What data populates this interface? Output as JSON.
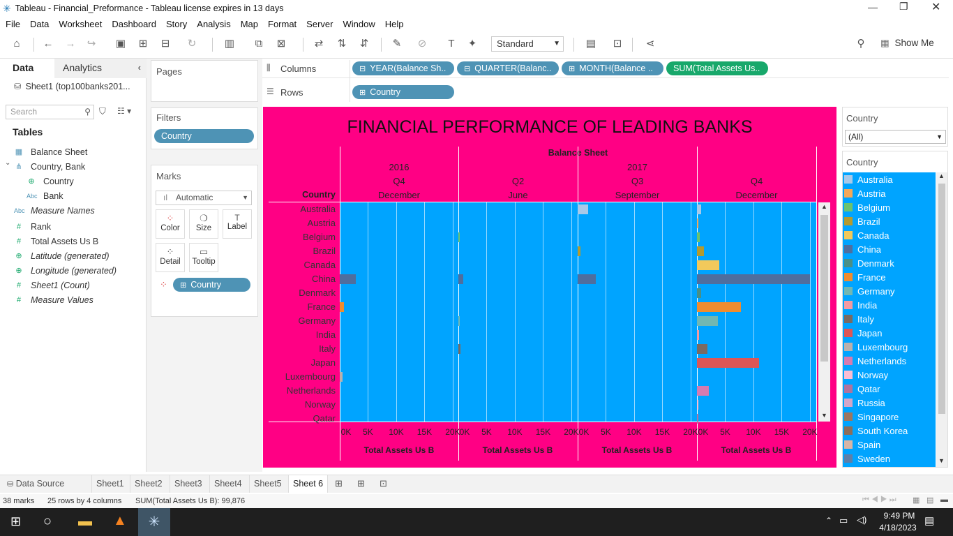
{
  "window": {
    "title": "Tableau - Financial_Preformance - Tableau license expires in 13 days"
  },
  "menu": [
    "File",
    "Data",
    "Worksheet",
    "Dashboard",
    "Story",
    "Analysis",
    "Map",
    "Format",
    "Server",
    "Window",
    "Help"
  ],
  "toolbar": {
    "fit_select": "Standard",
    "show_me": "Show Me"
  },
  "datapane": {
    "tab_data": "Data",
    "tab_analytics": "Analytics",
    "source": "Sheet1 (top100banks201...",
    "search_placeholder": "Search",
    "tables_heading": "Tables",
    "fields": [
      {
        "icon": "calendar-icon",
        "glyph": "▦",
        "label": "Balance Sheet",
        "italic": false,
        "indent": 0
      },
      {
        "icon": "hierarchy-icon",
        "glyph": "⋔",
        "label": "Country, Bank",
        "italic": false,
        "indent": 0
      },
      {
        "icon": "globe-icon",
        "glyph": "⊕",
        "label": "Country",
        "italic": false,
        "indent": 1
      },
      {
        "icon": "abc-icon",
        "glyph": "Abc",
        "label": "Bank",
        "italic": false,
        "indent": 1
      },
      {
        "icon": "abc-icon",
        "glyph": "Abc",
        "label": "Measure Names",
        "italic": true,
        "indent": 0
      },
      {
        "icon": "number-icon",
        "glyph": "#",
        "label": "Rank",
        "italic": false,
        "indent": 0
      },
      {
        "icon": "number-icon",
        "glyph": "#",
        "label": "Total Assets Us B",
        "italic": false,
        "indent": 0
      },
      {
        "icon": "globe-icon",
        "glyph": "⊕",
        "label": "Latitude (generated)",
        "italic": true,
        "indent": 0
      },
      {
        "icon": "globe-icon",
        "glyph": "⊕",
        "label": "Longitude (generated)",
        "italic": true,
        "indent": 0
      },
      {
        "icon": "number-icon",
        "glyph": "#",
        "label": "Sheet1 (Count)",
        "italic": true,
        "indent": 0
      },
      {
        "icon": "number-icon",
        "glyph": "#",
        "label": "Measure Values",
        "italic": true,
        "indent": 0
      }
    ]
  },
  "shelves": {
    "pages": "Pages",
    "filters": "Filters",
    "filter_pill": "Country",
    "marks": "Marks",
    "mark_type": "Automatic",
    "mark_buttons": [
      "Color",
      "Size",
      "Label",
      "Detail",
      "Tooltip"
    ],
    "color_pill": "Country",
    "columns_label": "Columns",
    "rows_label": "Rows",
    "columns": [
      "YEAR(Balance Sh..",
      "QUARTER(Balanc..",
      "MONTH(Balance ..",
      "SUM(Total Assets Us.."
    ],
    "rows": [
      "Country"
    ]
  },
  "viz": {
    "title": "FINANCIAL PERFORMANCE OF LEADING BANKS",
    "header_top": "Balance Sheet",
    "row_header": "Country",
    "years": [
      "2016",
      "2017"
    ],
    "panes": [
      {
        "quarter": "Q4",
        "month": "December"
      },
      {
        "quarter": "Q2",
        "month": "June"
      },
      {
        "quarter": "Q3",
        "month": "September"
      },
      {
        "quarter": "Q4",
        "month": "December"
      }
    ],
    "axis_title": "Total Assets Us B",
    "tick_labels": [
      "0K",
      "5K",
      "10K",
      "15K",
      "20K"
    ]
  },
  "chart_data": {
    "type": "bar",
    "orientation": "horizontal",
    "categories": [
      "Australia",
      "Austria",
      "Belgium",
      "Brazil",
      "Canada",
      "China",
      "Denmark",
      "France",
      "Germany",
      "India",
      "Italy",
      "Japan",
      "Luxembourg",
      "Netherlands",
      "Norway",
      "Qatar"
    ],
    "xlim": [
      0,
      21000
    ],
    "series": [
      {
        "name": "2016 Q4 December",
        "values": [
          0,
          0,
          0,
          0,
          0,
          2900,
          0,
          800,
          0,
          0,
          0,
          0,
          500,
          0,
          0,
          0
        ]
      },
      {
        "name": "2017 Q2 June",
        "values": [
          0,
          0,
          150,
          0,
          0,
          900,
          0,
          0,
          150,
          0,
          400,
          0,
          0,
          0,
          0,
          0
        ]
      },
      {
        "name": "2017 Q3 September",
        "values": [
          1800,
          0,
          0,
          500,
          0,
          3200,
          0,
          0,
          0,
          0,
          0,
          0,
          0,
          0,
          0,
          0
        ]
      },
      {
        "name": "2017 Q4 December",
        "values": [
          700,
          200,
          500,
          1200,
          4000,
          20000,
          700,
          7800,
          3700,
          400,
          1800,
          11000,
          0,
          2100,
          300,
          200
        ]
      }
    ],
    "colors": {
      "Australia": "#a9c9e8",
      "Austria": "#f5a858",
      "Belgium": "#6dc26d",
      "Brazil": "#b49a2e",
      "Canada": "#f2c95b",
      "China": "#4f6e9e",
      "Denmark": "#4a8f86",
      "France": "#f08c2e",
      "Germany": "#72b7b2",
      "India": "#f49aa2",
      "Italy": "#7a6a62",
      "Japan": "#dd5656",
      "Luxembourg": "#bab0ac",
      "Netherlands": "#d57bb0",
      "Norway": "#fbbdd2",
      "Qatar": "#b0739e"
    }
  },
  "filter_card": {
    "title": "Country",
    "value": "(All)"
  },
  "legend": {
    "title": "Country",
    "items": [
      {
        "label": "Australia",
        "color": "#a9c9e8"
      },
      {
        "label": "Austria",
        "color": "#f5a858"
      },
      {
        "label": "Belgium",
        "color": "#6dc26d"
      },
      {
        "label": "Brazil",
        "color": "#b49a2e"
      },
      {
        "label": "Canada",
        "color": "#f2c95b"
      },
      {
        "label": "China",
        "color": "#4f6e9e"
      },
      {
        "label": "Denmark",
        "color": "#4a8f86"
      },
      {
        "label": "France",
        "color": "#f08c2e"
      },
      {
        "label": "Germany",
        "color": "#72b7b2"
      },
      {
        "label": "India",
        "color": "#f49aa2"
      },
      {
        "label": "Italy",
        "color": "#7a6a62"
      },
      {
        "label": "Japan",
        "color": "#dd5656"
      },
      {
        "label": "Luxembourg",
        "color": "#bab0ac"
      },
      {
        "label": "Netherlands",
        "color": "#d57bb0"
      },
      {
        "label": "Norway",
        "color": "#fbbdd2"
      },
      {
        "label": "Qatar",
        "color": "#b0739e"
      },
      {
        "label": "Russia",
        "color": "#d4a6c8"
      },
      {
        "label": "Singapore",
        "color": "#9d7660"
      },
      {
        "label": "South Korea",
        "color": "#8c6d5a"
      },
      {
        "label": "Spain",
        "color": "#d7b5a6"
      },
      {
        "label": "Sweden",
        "color": "#5f7fa8"
      }
    ]
  },
  "sheet_tabs": {
    "data_source": "Data Source",
    "sheets": [
      "Sheet1",
      "Sheet2",
      "Sheet3",
      "Sheet4",
      "Sheet5",
      "Sheet 6"
    ],
    "active": "Sheet 6"
  },
  "statusbar": {
    "marks": "38 marks",
    "dims": "25 rows by 4 columns",
    "sum": "SUM(Total Assets Us B): 99,876"
  },
  "taskbar": {
    "time": "9:49 PM",
    "date": "4/18/2023"
  }
}
